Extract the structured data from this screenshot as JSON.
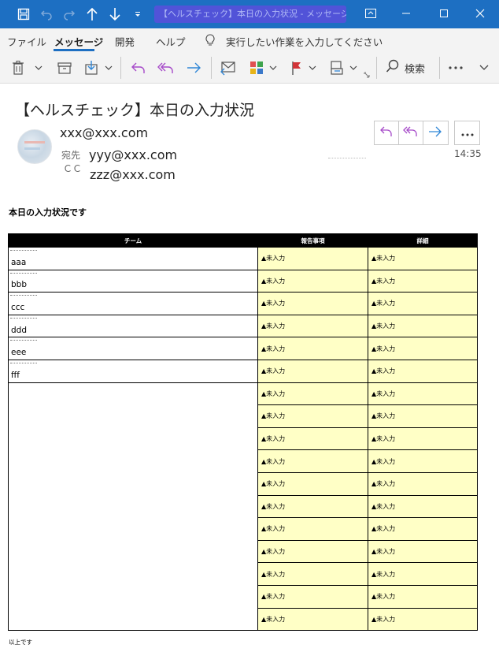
{
  "titlebar": {
    "title": "【ヘルスチェック】本日の入力状況 - メッセージ (HTML)"
  },
  "menu": {
    "items": [
      "ファイル",
      "メッセージ",
      "開発",
      "ヘルプ"
    ],
    "tell_me": "実行したい作業を入力してください"
  },
  "ribbon": {
    "search_label": "検索"
  },
  "message": {
    "subject": "【ヘルスチェック】本日の入力状況",
    "from": "xxx@xxx.com",
    "to_label": "宛先",
    "cc_label": "ＣＣ",
    "to": "yyy@xxx.com",
    "cc": "zzz@xxx.com",
    "time": "14:35"
  },
  "body": {
    "intro": "本日の入力状況です",
    "closing": "以上です"
  },
  "table": {
    "headers": [
      "チーム",
      "報告事項",
      "詳細"
    ],
    "rows": [
      {
        "team": "aaa",
        "report": "▲未入力",
        "detail": "▲未入力"
      },
      {
        "team": "bbb",
        "report": "▲未入力",
        "detail": "▲未入力"
      },
      {
        "team": "ccc",
        "report": "▲未入力",
        "detail": "▲未入力"
      },
      {
        "team": "ddd",
        "report": "▲未入力",
        "detail": "▲未入力"
      },
      {
        "team": "eee",
        "report": "▲未入力",
        "detail": "▲未入力"
      },
      {
        "team": "fff",
        "report": "▲未入力",
        "detail": "▲未入力"
      },
      {
        "team": "",
        "report": "▲未入力",
        "detail": "▲未入力"
      },
      {
        "team": "",
        "report": "▲未入力",
        "detail": "▲未入力"
      },
      {
        "team": "",
        "report": "▲未入力",
        "detail": "▲未入力"
      },
      {
        "team": "",
        "report": "▲未入力",
        "detail": "▲未入力"
      },
      {
        "team": "",
        "report": "▲未入力",
        "detail": "▲未入力"
      },
      {
        "team": "",
        "report": "▲未入力",
        "detail": "▲未入力"
      },
      {
        "team": "",
        "report": "▲未入力",
        "detail": "▲未入力"
      },
      {
        "team": "",
        "report": "▲未入力",
        "detail": "▲未入力"
      },
      {
        "team": "",
        "report": "▲未入力",
        "detail": "▲未入力"
      },
      {
        "team": "",
        "report": "▲未入力",
        "detail": "▲未入力"
      },
      {
        "team": "",
        "report": "▲未入力",
        "detail": "▲未入力"
      }
    ]
  },
  "colors": {
    "titlebar": "#1d6fc2",
    "accent_purple": "#a64ac9",
    "accent_blue": "#2f86d6",
    "cell_yellow": "#ffffc6",
    "header_black": "#000000"
  },
  "icons": [
    "save-icon",
    "undo-icon",
    "redo-icon",
    "up-arrow-icon",
    "down-arrow-icon",
    "customize-icon",
    "ribbon-display-icon",
    "minimize-icon",
    "maximize-icon",
    "close-icon",
    "lightbulb-icon",
    "delete-icon",
    "archive-icon",
    "move-icon",
    "reply-icon",
    "reply-all-icon",
    "forward-icon",
    "meeting-reply-icon",
    "categorize-icon",
    "flag-icon",
    "rules-icon",
    "search-icon",
    "more-icon"
  ]
}
